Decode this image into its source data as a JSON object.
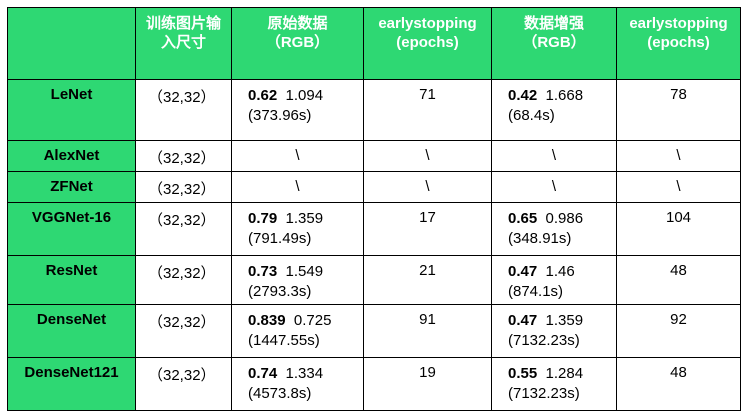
{
  "headers": [
    "",
    "训练图片输入尺寸",
    "原始数据（RGB）",
    "earlystopping (epochs)",
    "数据增强（RGB）",
    "earlystopping (epochs)"
  ],
  "header_lines": [
    [
      ""
    ],
    [
      "训练图片输",
      "入尺寸"
    ],
    [
      "原始数据",
      "（RGB）"
    ],
    [
      "earlystopping",
      "(epochs)"
    ],
    [
      "数据增强",
      "（RGB）"
    ],
    [
      "earlystopping",
      "(epochs)"
    ]
  ],
  "rows": [
    {
      "model": "LeNet",
      "size": "（32,32）",
      "raw_acc": "0.62",
      "raw_loss": "1.094",
      "raw_time": "(373.96s)",
      "raw_epochs": "71",
      "aug_acc": "0.42",
      "aug_loss": "1.668",
      "aug_time": "(68.4s)",
      "aug_epochs": "78"
    },
    {
      "model": "AlexNet",
      "size": "（32,32）",
      "raw_acc": "",
      "raw_loss": "",
      "raw_time": "",
      "raw_na": "\\",
      "raw_epochs": "\\",
      "aug_acc": "",
      "aug_loss": "",
      "aug_time": "",
      "aug_na": "\\",
      "aug_epochs": "\\"
    },
    {
      "model": "ZFNet",
      "size": "（32,32）",
      "raw_acc": "",
      "raw_loss": "",
      "raw_time": "",
      "raw_na": "\\",
      "raw_epochs": "\\",
      "aug_acc": "",
      "aug_loss": "",
      "aug_time": "",
      "aug_na": "\\",
      "aug_epochs": "\\"
    },
    {
      "model": "VGGNet-16",
      "size": "（32,32）",
      "raw_acc": "0.79",
      "raw_loss": "1.359",
      "raw_time": "(791.49s)",
      "raw_epochs": "17",
      "aug_acc": "0.65",
      "aug_loss": "0.986",
      "aug_time": "(348.91s)",
      "aug_epochs": "104"
    },
    {
      "model": "ResNet",
      "size": "（32,32）",
      "raw_acc": "0.73",
      "raw_loss": "1.549",
      "raw_time": "(2793.3s)",
      "raw_epochs": "21",
      "aug_acc": "0.47",
      "aug_loss": "1.46",
      "aug_time": "(874.1s)",
      "aug_epochs": "48"
    },
    {
      "model": "DenseNet",
      "size": "（32,32）",
      "raw_acc": "0.839",
      "raw_loss": "0.725",
      "raw_time": "(1447.55s)",
      "raw_epochs": "91",
      "aug_acc": "0.47",
      "aug_loss": "1.359",
      "aug_time": "(7132.23s)",
      "aug_epochs": "92"
    },
    {
      "model": "DenseNet121",
      "size": "（32,32）",
      "raw_acc": "0.74",
      "raw_loss": "1.334",
      "raw_time": "(4573.8s)",
      "raw_epochs": "19",
      "aug_acc": "0.55",
      "aug_loss": "1.284",
      "aug_time": "(7132.23s)",
      "aug_epochs": "48"
    }
  ],
  "colors": {
    "header_bg": "#2ed873",
    "header_text": "#ffffff",
    "border": "#000000"
  }
}
